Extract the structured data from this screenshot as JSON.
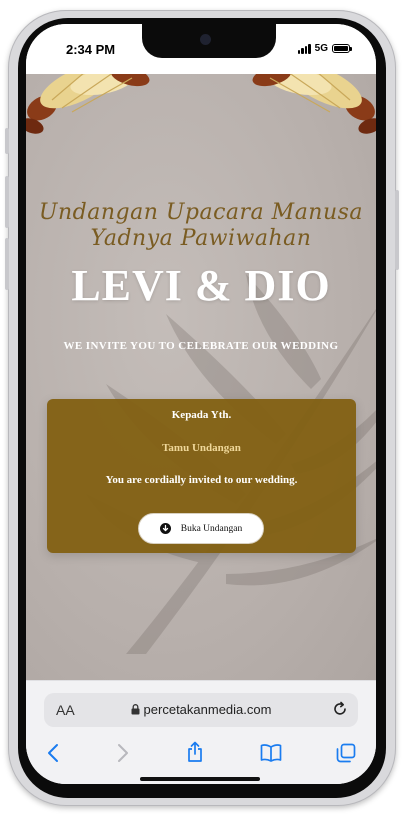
{
  "status_bar": {
    "time": "2:34 PM",
    "network": "5G",
    "signal_bars": 4,
    "battery_level": 1.0
  },
  "invitation": {
    "script_title_line1": "Undangan Upacara Manusa",
    "script_title_line2": "Yadnya Pawiwahan",
    "couple_names": "LEVI & DIO",
    "tagline": "WE INVITE YOU TO CELEBRATE OUR WEDDING",
    "card": {
      "greeting": "Kepada Yth.",
      "guest_name": "Tamu Undangan",
      "message": "You are cordially invited to our wedding.",
      "open_button_label": "Buka Undangan"
    }
  },
  "browser": {
    "text_size_label": "AA",
    "url": "percetakanmedia.com",
    "toolbar_icons": [
      "back-icon",
      "forward-icon",
      "share-icon",
      "bookmarks-icon",
      "tabs-icon"
    ]
  },
  "colors": {
    "card_background": "#82601a",
    "script_text": "#7a5c22",
    "guest_name_text": "#f0d89a",
    "page_background": "#bbb4b0",
    "safari_accent": "#1a7cf0"
  }
}
